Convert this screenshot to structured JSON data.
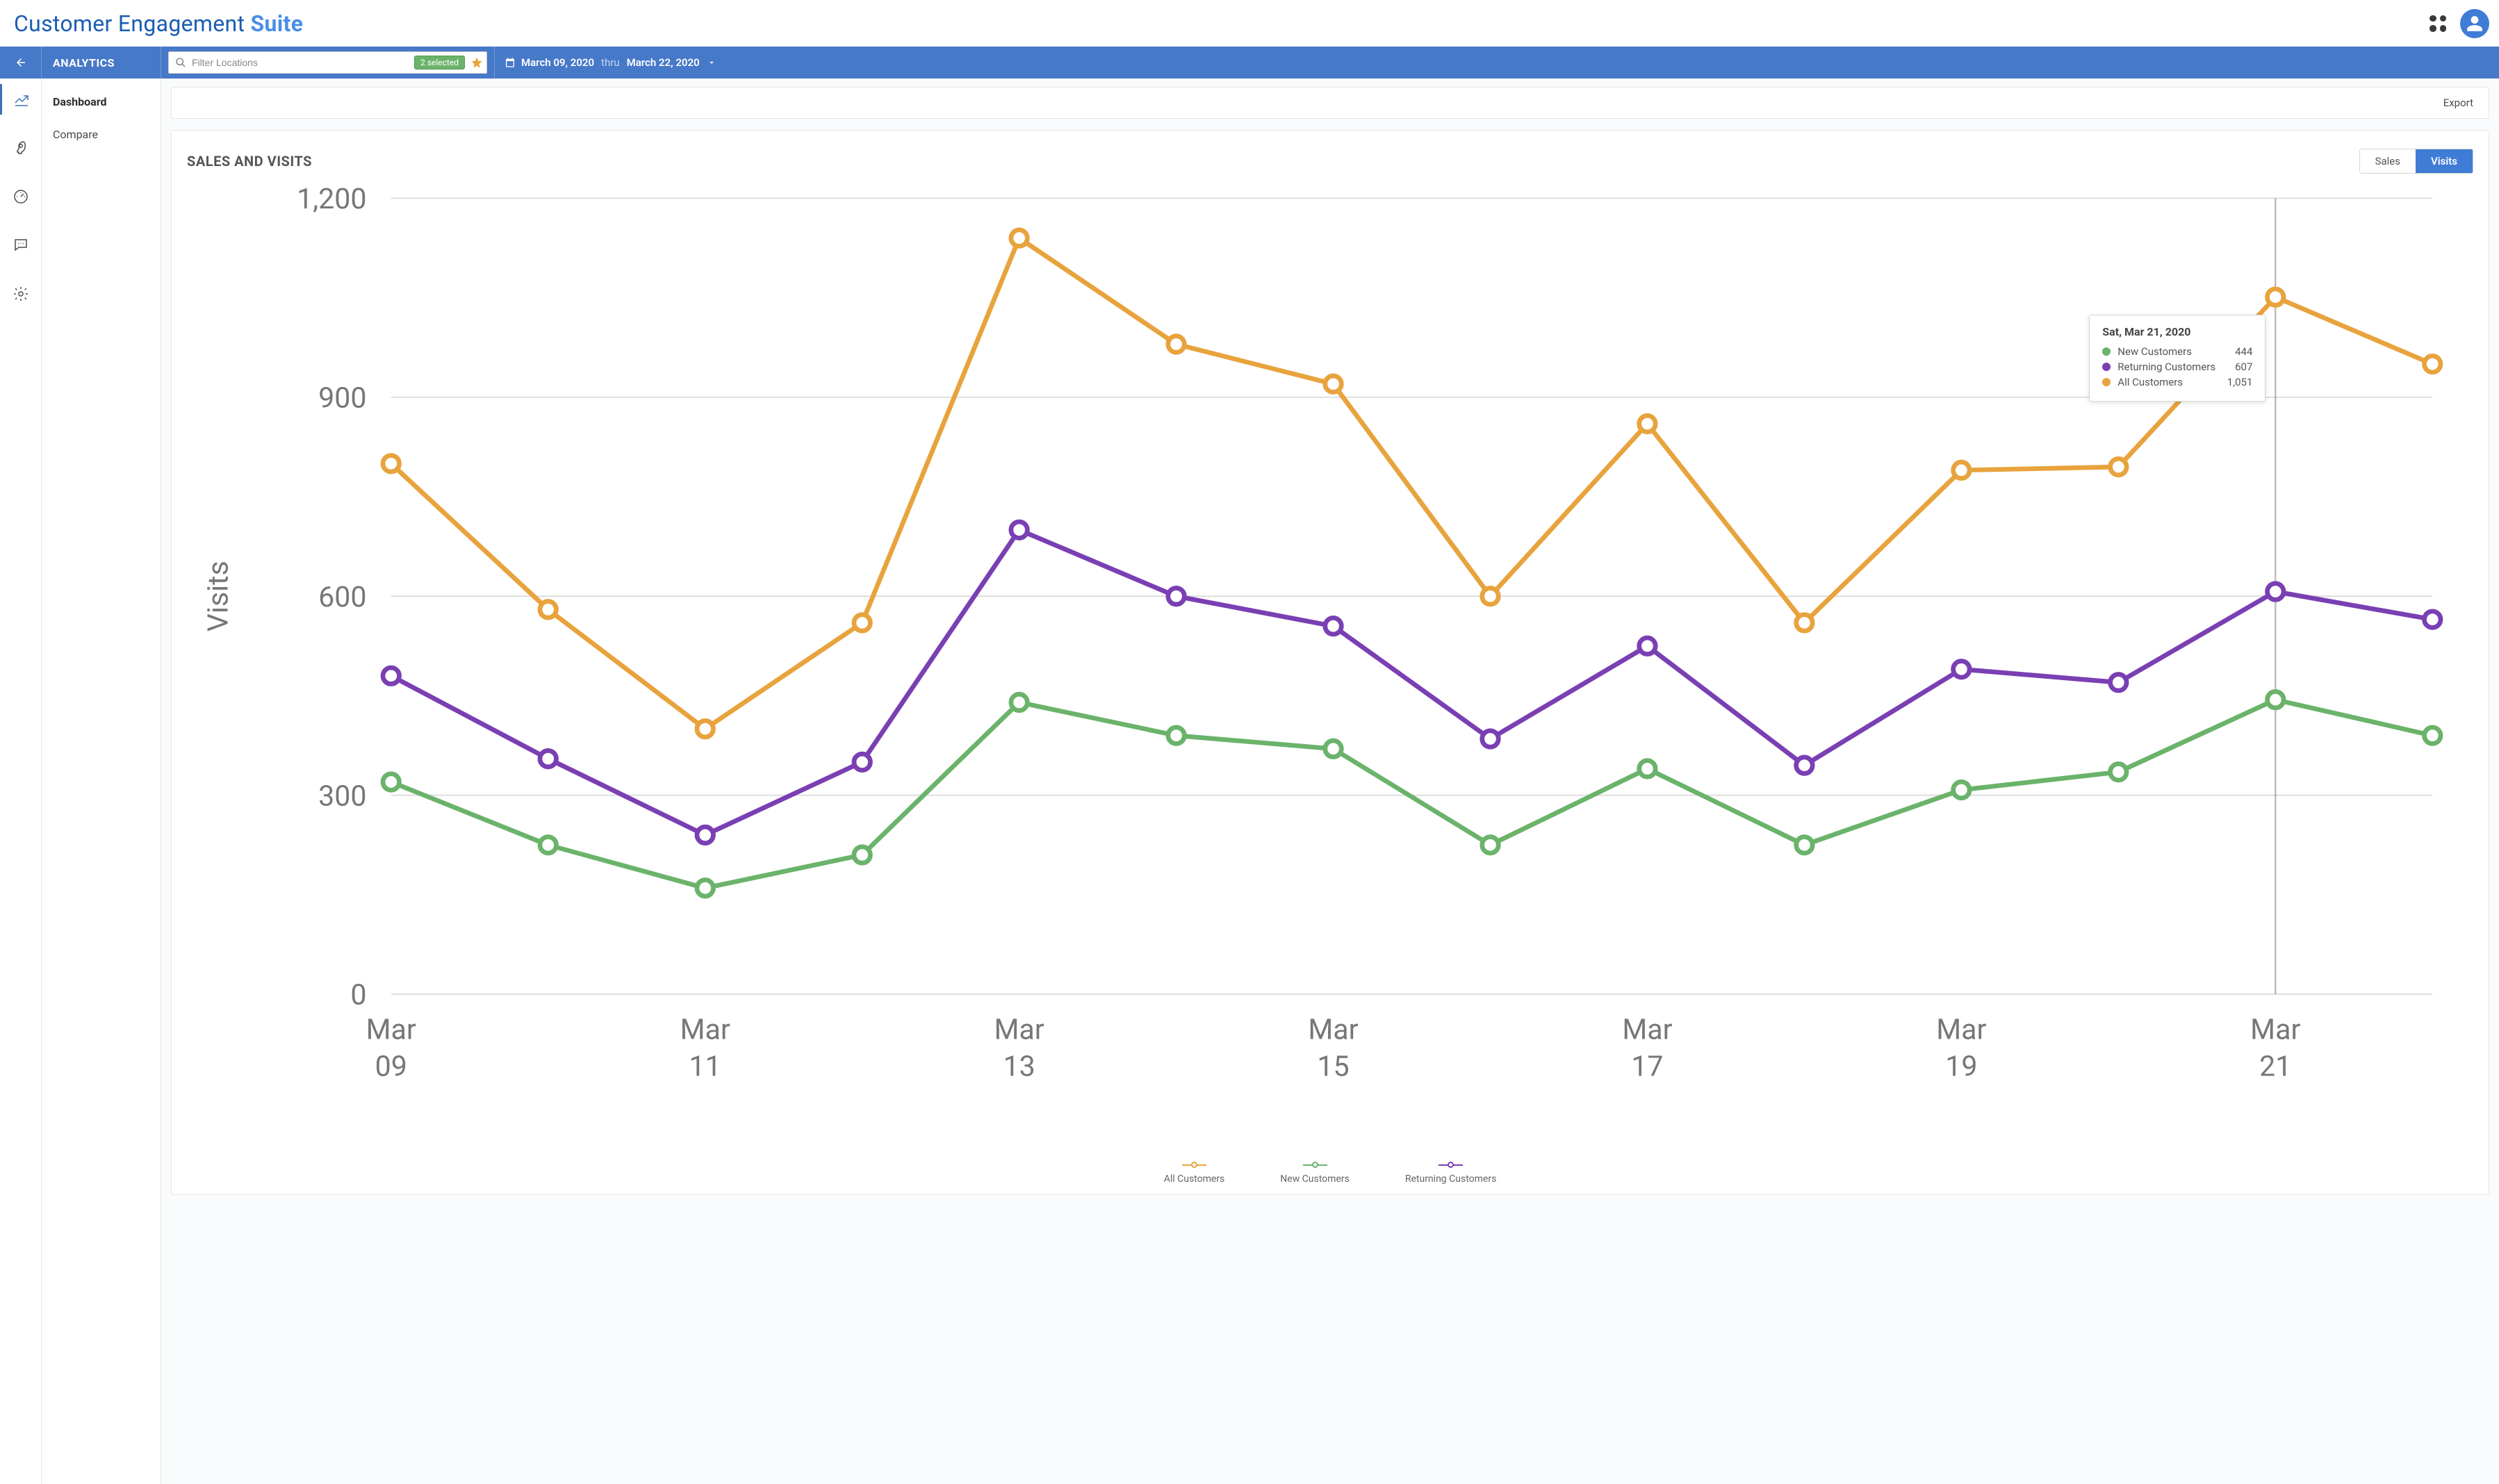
{
  "brand": {
    "text1": "Customer Engagement ",
    "text2": "Suite"
  },
  "toolbar": {
    "section": "ANALYTICS",
    "filter_placeholder": "Filter Locations",
    "filter_badge": "2 selected",
    "date_start": "March 09, 2020",
    "date_thru": "thru",
    "date_end": "March 22, 2020"
  },
  "subnav": {
    "items": [
      {
        "label": "Dashboard",
        "active": true
      },
      {
        "label": "Compare",
        "active": false
      }
    ]
  },
  "export_label": "Export",
  "chart": {
    "title": "SALES AND VISITS",
    "toggle": {
      "sales": "Sales",
      "visits": "Visits",
      "active": "visits"
    },
    "ylabel": "Visits"
  },
  "tooltip": {
    "title": "Sat, Mar 21, 2020",
    "rows": [
      {
        "label": "New Customers",
        "value": "444",
        "color": "#6bb36b"
      },
      {
        "label": "Returning Customers",
        "value": "607",
        "color": "#7a3fb3"
      },
      {
        "label": "All Customers",
        "value": "1,051",
        "color": "#e8a33d"
      }
    ]
  },
  "legend": [
    {
      "label": "All Customers",
      "color": "#e8a33d"
    },
    {
      "label": "New Customers",
      "color": "#6bb36b"
    },
    {
      "label": "Returning Customers",
      "color": "#7a3fb3"
    }
  ],
  "chart_data": {
    "type": "line",
    "xlabel": "",
    "ylabel": "Visits",
    "ylim": [
      0,
      1200
    ],
    "yticks": [
      0,
      300,
      600,
      900,
      1200
    ],
    "x": [
      "Mar 09",
      "Mar 10",
      "Mar 11",
      "Mar 12",
      "Mar 13",
      "Mar 14",
      "Mar 15",
      "Mar 16",
      "Mar 17",
      "Mar 18",
      "Mar 19",
      "Mar 20",
      "Mar 21",
      "Mar 22"
    ],
    "xticks_shown": [
      "Mar 09",
      "Mar 11",
      "Mar 13",
      "Mar 15",
      "Mar 17",
      "Mar 19",
      "Mar 21"
    ],
    "series": [
      {
        "name": "All Customers",
        "color": "#e8a33d",
        "values": [
          800,
          580,
          400,
          560,
          1140,
          980,
          920,
          600,
          860,
          560,
          790,
          795,
          1051,
          950
        ]
      },
      {
        "name": "New Customers",
        "color": "#6bb36b",
        "values": [
          320,
          225,
          160,
          210,
          440,
          390,
          370,
          225,
          340,
          225,
          308,
          335,
          444,
          390
        ]
      },
      {
        "name": "Returning Customers",
        "color": "#7a3fb3",
        "values": [
          480,
          355,
          240,
          350,
          700,
          600,
          555,
          385,
          525,
          345,
          490,
          470,
          607,
          565
        ]
      }
    ],
    "hover_index": 12,
    "title": "SALES AND VISITS"
  }
}
